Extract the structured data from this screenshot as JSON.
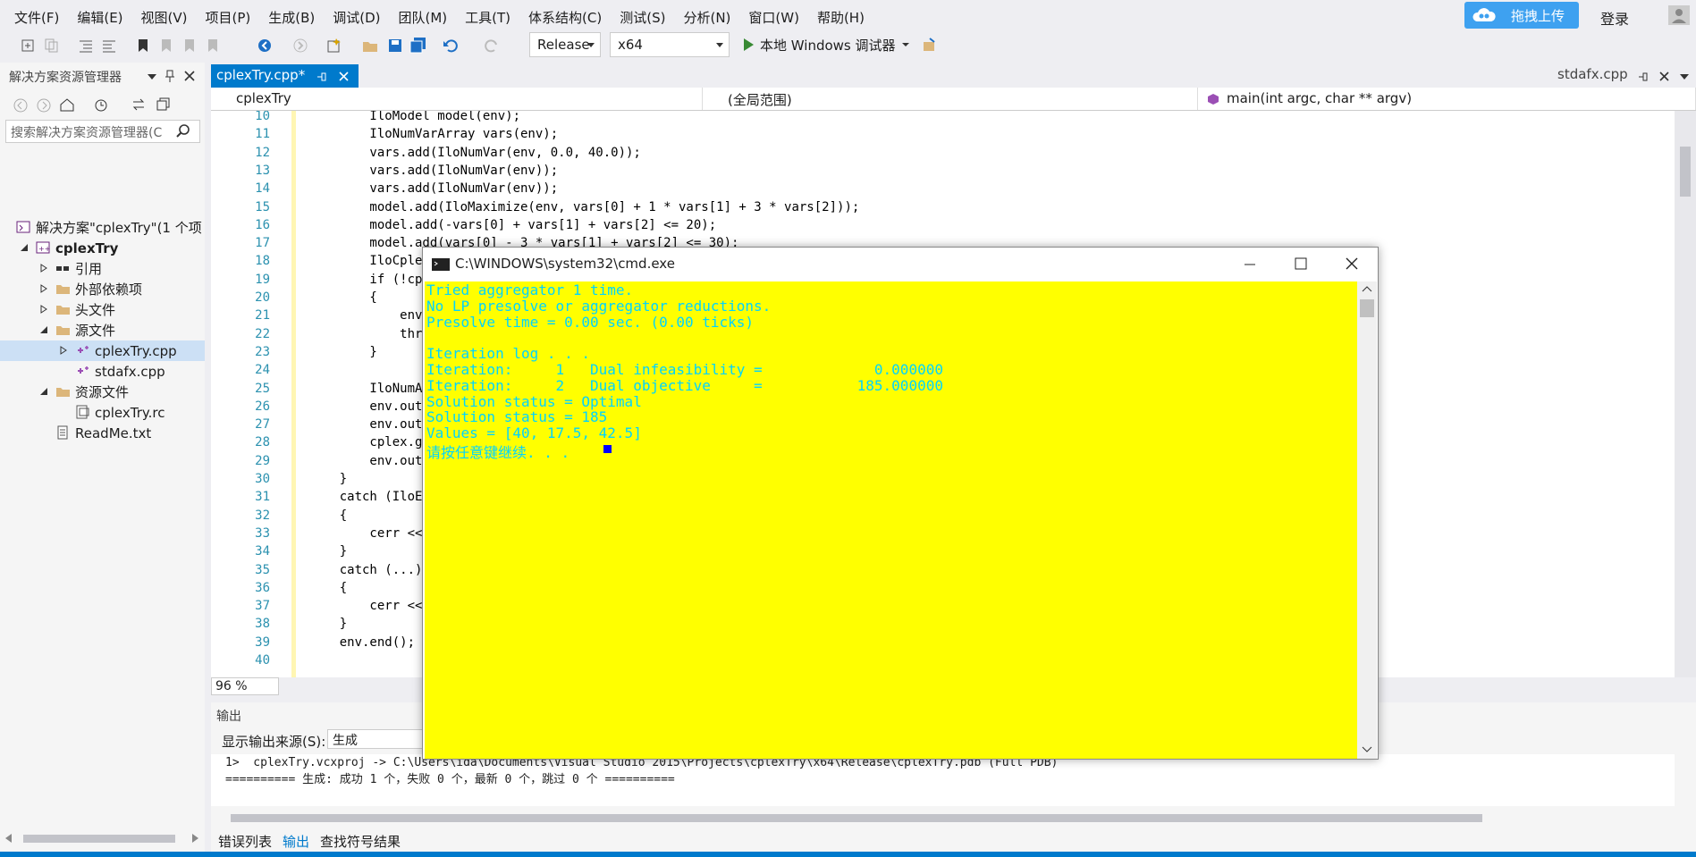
{
  "menu": [
    "文件(F)",
    "编辑(E)",
    "视图(V)",
    "项目(P)",
    "生成(B)",
    "调试(D)",
    "团队(M)",
    "工具(T)",
    "体系结构(C)",
    "测试(S)",
    "分析(N)",
    "窗口(W)",
    "帮助(H)"
  ],
  "topright": {
    "upload_label": "拖拽上传",
    "login_label": "登录"
  },
  "toolbar": {
    "config": "Release",
    "platform": "x64",
    "debugger_label": "本地 Windows 调试器"
  },
  "solution_explorer": {
    "title": "解决方案资源管理器",
    "search_placeholder": "搜索解决方案资源管理器(C",
    "items": [
      {
        "label": "解决方案\"cplexTry\"(1 个项"
      },
      {
        "label": "cplexTry"
      },
      {
        "label": "引用"
      },
      {
        "label": "外部依赖项"
      },
      {
        "label": "头文件"
      },
      {
        "label": "源文件"
      },
      {
        "label": "cplexTry.cpp"
      },
      {
        "label": "stdafx.cpp"
      },
      {
        "label": "资源文件"
      },
      {
        "label": "cplexTry.rc"
      },
      {
        "label": "ReadMe.txt"
      }
    ]
  },
  "editor": {
    "active_tab": "cplexTry.cpp*",
    "other_tab": "stdafx.cpp",
    "nav_project": "cplexTry",
    "nav_scope": "(全局范围)",
    "nav_function": "main(int argc, char ** argv)",
    "zoom": "96 %",
    "line_numbers": [
      "10",
      "11",
      "12",
      "13",
      "14",
      "15",
      "16",
      "17",
      "18",
      "19",
      "20",
      "21",
      "22",
      "23",
      "24",
      "25",
      "26",
      "27",
      "28",
      "29",
      "30",
      "31",
      "32",
      "33",
      "34",
      "35",
      "36",
      "37",
      "38",
      "39",
      "40"
    ],
    "code_lines": [
      "        IloModel model(env);",
      "        IloNumVarArray vars(env);",
      "        vars.add(IloNumVar(env, 0.0, 40.0));",
      "        vars.add(IloNumVar(env));",
      "        vars.add(IloNumVar(env));",
      "        model.add(IloMaximize(env, vars[0] + 1 * vars[1] + 3 * vars[2]));",
      "        model.add(-vars[0] + vars[1] + vars[2] <= 20);",
      "        model.add(vars[0] - 3 * vars[1] + vars[2] <= 30);",
      "        IloCple",
      "        if (!cp",
      "        {",
      "            env",
      "            thr",
      "        }",
      "",
      "        IloNumA",
      "        env.out",
      "        env.out",
      "        cplex.g",
      "        env.out",
      "    }",
      "    catch (IloE",
      "    {",
      "        cerr <<",
      "    }",
      "    catch (...)",
      "    {",
      "        cerr <<",
      "    }",
      "    env.end();",
      ""
    ]
  },
  "output": {
    "title": "输出",
    "source_label": "显示输出来源(S):",
    "source_value": "生成",
    "lines": [
      "1>  cplexTry.vcxproj -> C:\\Users\\ida\\Documents\\Visual Studio 2015\\Projects\\cplexTry\\x64\\Release\\cplexTry.pdb (Full PDB)",
      "========== 生成: 成功 1 个，失败 0 个，最新 0 个，跳过 0 个 =========="
    ]
  },
  "bottom_tabs": [
    "错误列表",
    "输出",
    "查找符号结果"
  ],
  "cmd": {
    "title": "C:\\WINDOWS\\system32\\cmd.exe",
    "lines": [
      "Tried aggregator 1 time.",
      "No LP presolve or aggregator reductions.",
      "Presolve time = 0.00 sec. (0.00 ticks)",
      "",
      "Iteration log . . .",
      "Iteration:     1   Dual infeasibility =             0.000000",
      "Iteration:     2   Dual objective     =           185.000000",
      "Solution status = Optimal",
      "Solution status = 185",
      "Values = [40, 17.5, 42.5]",
      "请按任意键继续. . ."
    ]
  },
  "colors": {
    "accent": "#007acc",
    "console_bg": "#ffff00",
    "console_text": "#00d4ff",
    "upload_btn": "#3ea1f0"
  }
}
